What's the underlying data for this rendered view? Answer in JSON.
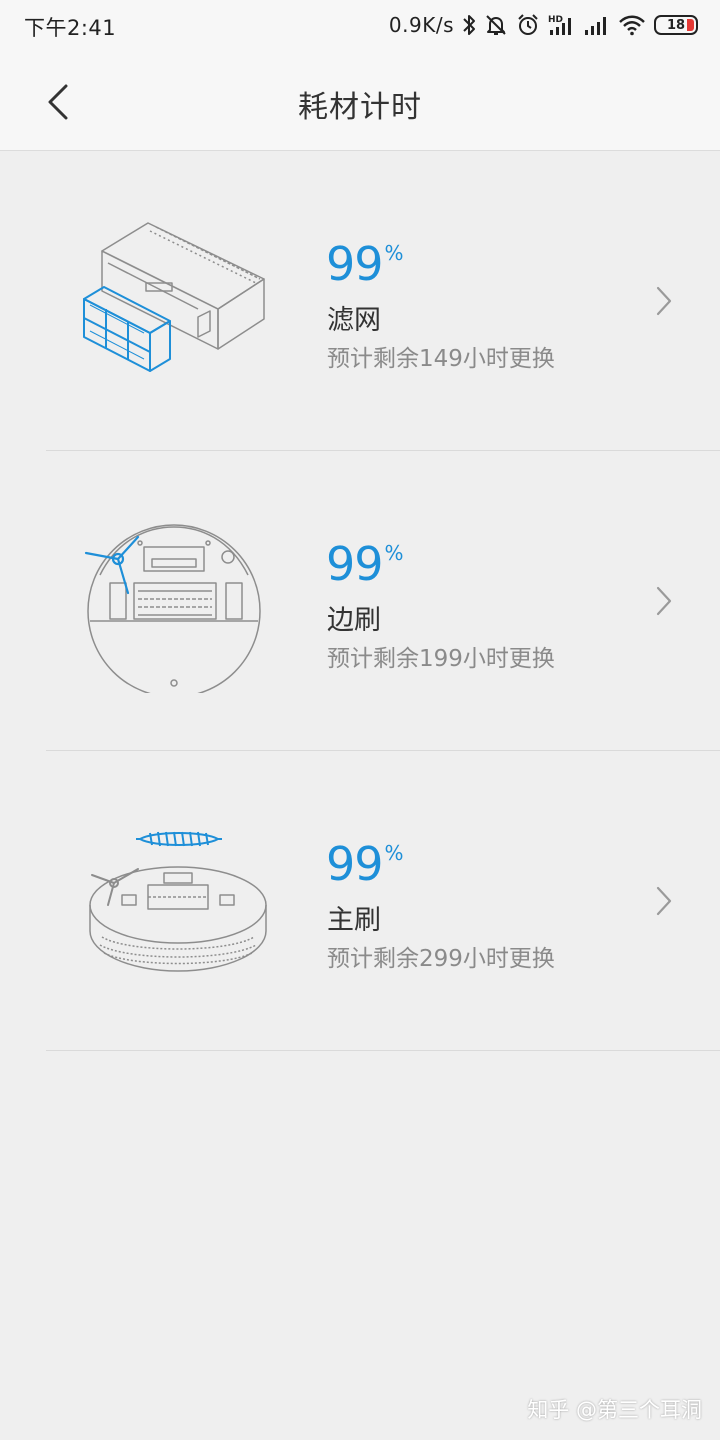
{
  "status_bar": {
    "time": "下午2:41",
    "net_speed": "0.9K/s",
    "battery_level": "18",
    "icons": [
      "bluetooth-icon",
      "mute-bell-icon",
      "alarm-icon",
      "hd-signal-icon",
      "signal-icon",
      "wifi-icon",
      "battery-icon"
    ]
  },
  "header": {
    "title": "耗材计时",
    "back_icon": "chevron-left-icon"
  },
  "consumables": [
    {
      "percent": "99",
      "unit": "%",
      "name": "滤网",
      "remaining": "预计剩余149小时更换",
      "illustration": "filter-illustration"
    },
    {
      "percent": "99",
      "unit": "%",
      "name": "边刷",
      "remaining": "预计剩余199小时更换",
      "illustration": "side-brush-illustration"
    },
    {
      "percent": "99",
      "unit": "%",
      "name": "主刷",
      "remaining": "预计剩余299小时更换",
      "illustration": "main-brush-illustration"
    }
  ],
  "watermark": "知乎 @第三个耳洞",
  "colors": {
    "accent": "#1e8fd8",
    "background": "#efefef",
    "header_background": "#f7f7f7",
    "battery_low": "#e53935"
  }
}
